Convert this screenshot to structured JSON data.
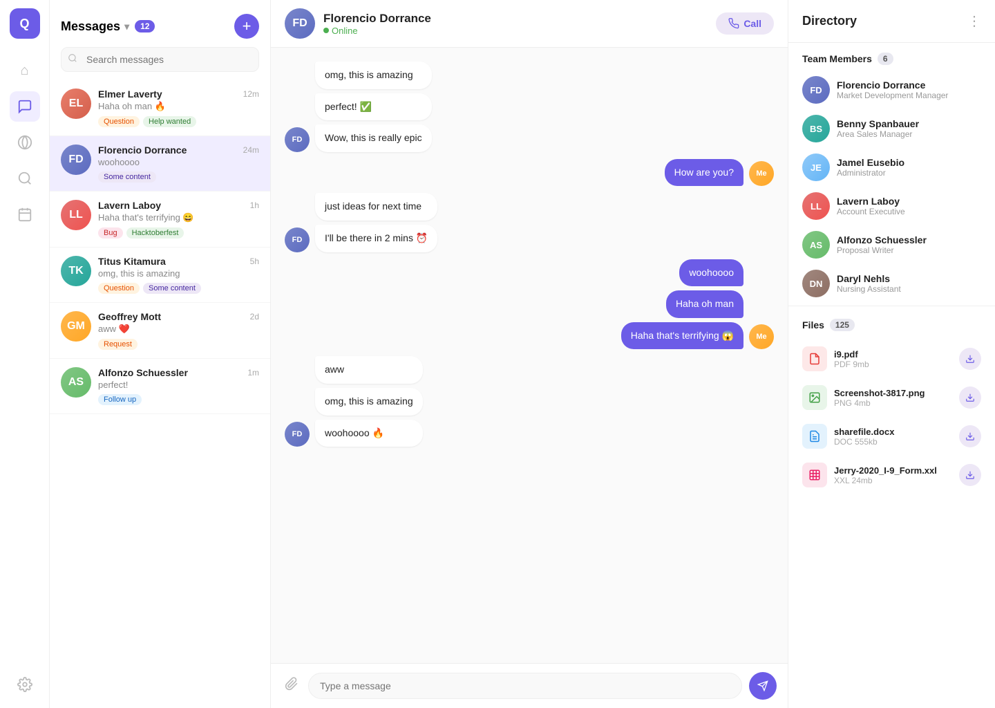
{
  "app": {
    "logo": "Q"
  },
  "nav": {
    "items": [
      {
        "id": "home",
        "icon": "⌂",
        "active": false
      },
      {
        "id": "messages",
        "icon": "💬",
        "active": true
      },
      {
        "id": "analytics",
        "icon": "📊",
        "active": false
      },
      {
        "id": "search",
        "icon": "🔍",
        "active": false
      },
      {
        "id": "calendar",
        "icon": "📅",
        "active": false
      }
    ],
    "settings_icon": "⚙"
  },
  "messages_panel": {
    "title": "Messages",
    "count": "12",
    "search_placeholder": "Search messages",
    "conversations": [
      {
        "id": "elmer",
        "name": "Elmer Laverty",
        "preview": "Haha oh man 🔥",
        "time": "12m",
        "tags": [
          {
            "label": "Question",
            "type": "question"
          },
          {
            "label": "Help wanted",
            "type": "help"
          }
        ],
        "avatar_class": "av-elmer"
      },
      {
        "id": "florencio",
        "name": "Florencio Dorrance",
        "preview": "woohoooo",
        "time": "24m",
        "tags": [
          {
            "label": "Some content",
            "type": "some"
          }
        ],
        "avatar_class": "av-florencio",
        "active": true
      },
      {
        "id": "lavern",
        "name": "Lavern Laboy",
        "preview": "Haha that's terrifying 😄",
        "time": "1h",
        "tags": [
          {
            "label": "Bug",
            "type": "bug"
          },
          {
            "label": "Hacktoberfest",
            "type": "hacktoberfest"
          }
        ],
        "avatar_class": "av-lavern"
      },
      {
        "id": "titus",
        "name": "Titus Kitamura",
        "preview": "omg, this is amazing",
        "time": "5h",
        "tags": [
          {
            "label": "Question",
            "type": "question"
          },
          {
            "label": "Some content",
            "type": "some"
          }
        ],
        "avatar_class": "av-titus"
      },
      {
        "id": "geoffrey",
        "name": "Geoffrey Mott",
        "preview": "aww ❤️",
        "time": "2d",
        "tags": [
          {
            "label": "Request",
            "type": "request"
          }
        ],
        "avatar_class": "av-geoffrey"
      },
      {
        "id": "alfonzo",
        "name": "Alfonzo Schuessler",
        "preview": "perfect!",
        "time": "1m",
        "tags": [
          {
            "label": "Follow up",
            "type": "follow"
          }
        ],
        "avatar_class": "av-alfonzo"
      }
    ]
  },
  "chat": {
    "contact_name": "Florencio Dorrance",
    "status": "Online",
    "call_label": "Call",
    "messages": [
      {
        "id": "m1",
        "type": "received",
        "text": "omg, this is amazing",
        "group": "g1"
      },
      {
        "id": "m2",
        "type": "received",
        "text": "perfect! ✅",
        "group": "g1"
      },
      {
        "id": "m3",
        "type": "received",
        "text": "Wow, this is really epic",
        "group": "g1"
      },
      {
        "id": "m4",
        "type": "sent",
        "text": "How are you?",
        "group": "g2"
      },
      {
        "id": "m5",
        "type": "received",
        "text": "just ideas for next time",
        "group": "g3"
      },
      {
        "id": "m6",
        "type": "received",
        "text": "I'll be there in 2 mins ⏰",
        "group": "g3"
      },
      {
        "id": "m7",
        "type": "sent",
        "text": "woohoooo",
        "group": "g4"
      },
      {
        "id": "m8",
        "type": "sent",
        "text": "Haha oh man",
        "group": "g4"
      },
      {
        "id": "m9",
        "type": "sent",
        "text": "Haha that's terrifying 😱",
        "group": "g4"
      },
      {
        "id": "m10",
        "type": "received",
        "text": "aww",
        "group": "g5"
      },
      {
        "id": "m11",
        "type": "received",
        "text": "omg, this is amazing",
        "group": "g5"
      },
      {
        "id": "m12",
        "type": "received",
        "text": "woohoooo 🔥",
        "group": "g5"
      }
    ],
    "input_placeholder": "Type a message"
  },
  "directory": {
    "title": "Directory",
    "team_label": "Team Members",
    "team_count": "6",
    "members": [
      {
        "name": "Florencio Dorrance",
        "role": "Market Development Manager",
        "avatar_class": "av-florencio"
      },
      {
        "name": "Benny Spanbauer",
        "role": "Area Sales Manager",
        "avatar_class": "av-titus"
      },
      {
        "name": "Jamel Eusebio",
        "role": "Administrator",
        "avatar_class": "av-jamel"
      },
      {
        "name": "Lavern Laboy",
        "role": "Account Executive",
        "avatar_class": "av-lavern"
      },
      {
        "name": "Alfonzo Schuessler",
        "role": "Proposal Writer",
        "avatar_class": "av-alfonzo"
      },
      {
        "name": "Daryl Nehls",
        "role": "Nursing Assistant",
        "avatar_class": "av-daryl"
      }
    ],
    "files_label": "Files",
    "files_count": "125",
    "files": [
      {
        "name": "i9.pdf",
        "type": "PDF",
        "size": "9mb",
        "icon_type": "pdf",
        "icon": "📄"
      },
      {
        "name": "Screenshot-3817.png",
        "type": "PNG",
        "size": "4mb",
        "icon_type": "png",
        "icon": "🖼"
      },
      {
        "name": "sharefile.docx",
        "type": "DOC",
        "size": "555kb",
        "icon_type": "doc",
        "icon": "📝"
      },
      {
        "name": "Jerry-2020_I-9_Form.xxl",
        "type": "XXL",
        "size": "24mb",
        "icon_type": "xxl",
        "icon": "📊"
      }
    ]
  }
}
